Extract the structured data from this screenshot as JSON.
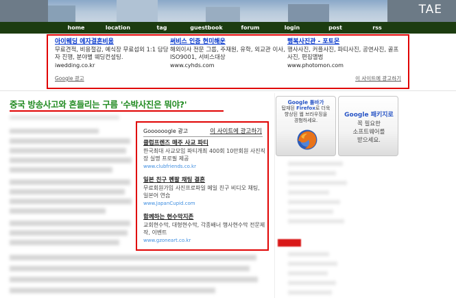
{
  "header": {
    "brand": "TAE"
  },
  "nav": [
    {
      "label": "home"
    },
    {
      "label": "location"
    },
    {
      "label": "tag"
    },
    {
      "label": "guestbook"
    },
    {
      "label": "forum"
    },
    {
      "label": "login"
    },
    {
      "label": "post"
    },
    {
      "label": "rss"
    }
  ],
  "top_ads": {
    "items": [
      {
        "title": "아이웨딩 에자결혼비용",
        "desc": "무료견적, 비용절감, 예식장 무료섭외 1:1 담당자 진행, 분야별 웨딩컨설팅.",
        "url": "iwedding.co.kr"
      },
      {
        "title": "써비스 인증 현미해운",
        "desc": "해외이사 전문 그룹, 주재원, 유학, 외교관 이사, ISO9001, 서비스대상",
        "url": "www.cyhds.com"
      },
      {
        "title": "행복사진관 - 포토몬",
        "desc": "행사사진, 커플사진, 파티사진, 공연사진, 골프사진, 편집앨범",
        "url": "www.photomon.com"
      }
    ],
    "google_label": "Google 광고",
    "advertise_link": "이 사이트에 광고하기"
  },
  "post": {
    "title": "중국 방송사고와 흔들리는 구름 '수박사진은 뭐야?'"
  },
  "inline_ads": {
    "label": "Goooooogle 광고",
    "advertise_link": "이 사이트에 광고하기",
    "items": [
      {
        "title": "클럽프렌즈 매주 사교 파티",
        "desc": "한국최대 사교모임 파티개최 400회 10만회원 사진직장 실명 프로필 제공",
        "url": "www.clubfriends.co.kr"
      },
      {
        "title": "일본 친구 펜팔 채팅 결혼",
        "desc": "무료회원가입 사진프로파일 메일 친구 비디오 채팅, 일본어 연습",
        "url": "www.JapanCupid.com"
      },
      {
        "title": "함께하는 현수막지존",
        "desc": "교회현수막, 대형현수막, 각종배너 행사현수막 전문제작, 이벤트",
        "url": "www.gzoneart.co.kr"
      }
    ]
  },
  "sidebar": {
    "firefox_promo": {
      "title": "Google 툴바가",
      "line1": "탑재된",
      "highlight": "Firefox",
      "line1b": "로 더욱",
      "line2": "향상된 웹 브라우징을",
      "line3": "경험하세요."
    },
    "pack_promo": {
      "title": "Google 패키지로",
      "line1": "꼭 필요한",
      "line2": "소프트웨어를",
      "line3": "받으세요."
    }
  },
  "colors": {
    "nav_bg": "#1c3c10",
    "ad_border": "#e00000",
    "link": "#0033cc",
    "post_title": "#228b22",
    "google_blue": "#2a56c6"
  }
}
